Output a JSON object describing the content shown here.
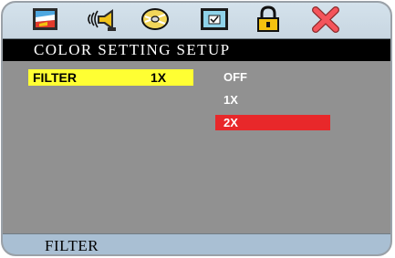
{
  "toolbar": {
    "icons": [
      {
        "name": "picture-icon",
        "selected": false
      },
      {
        "name": "audio-icon",
        "selected": false
      },
      {
        "name": "disc-icon",
        "selected": false
      },
      {
        "name": "display-icon",
        "selected": false
      },
      {
        "name": "lock-icon",
        "selected": false
      },
      {
        "name": "close-icon",
        "selected": false
      }
    ]
  },
  "title": "COLOR SETTING SETUP",
  "setting": {
    "label": "FILTER",
    "value": "1X"
  },
  "options": [
    {
      "label": "OFF",
      "selected": false
    },
    {
      "label": "1X",
      "selected": false
    },
    {
      "label": "2X",
      "selected": true
    }
  ],
  "status": "FILTER",
  "colors": {
    "highlight": "#ffff33",
    "selection": "#e8282a",
    "title_bar": "#000000",
    "content_bg": "#919191",
    "status_bar": "#a9bfd3"
  }
}
